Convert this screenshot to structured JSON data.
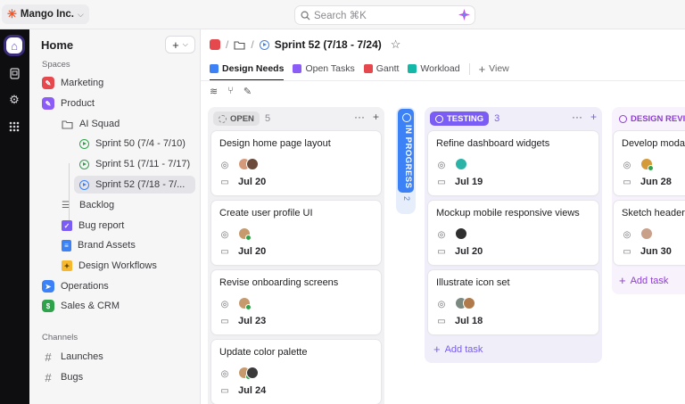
{
  "topbar": {
    "workspace": "Mango Inc.",
    "search_placeholder": "Search ⌘K"
  },
  "sidebar": {
    "title": "Home",
    "spaces_label": "Spaces",
    "channels_label": "Channels",
    "spaces": [
      {
        "label": "Marketing",
        "color": "#e5484d"
      },
      {
        "label": "Product",
        "color": "#8b5cf6"
      },
      {
        "label": "AI Squad"
      },
      {
        "label": "Sprint 50 (7/4 - 7/10)"
      },
      {
        "label": "Sprint 51 (7/11 - 7/17)"
      },
      {
        "label": "Sprint 52 (7/18 - 7/..."
      },
      {
        "label": "Backlog"
      },
      {
        "label": "Bug report"
      },
      {
        "label": "Brand Assets"
      },
      {
        "label": "Design Workflows"
      },
      {
        "label": "Operations",
        "color": "#3c82f6"
      },
      {
        "label": "Sales & CRM",
        "color": "#2fa34b",
        "letter": "$"
      }
    ],
    "channels": [
      {
        "label": "Launches"
      },
      {
        "label": "Bugs"
      }
    ]
  },
  "main": {
    "title": "Sprint 52 (7/18 - 7/24)",
    "tabs": [
      {
        "label": "Design Needs",
        "color": "#3c82f6"
      },
      {
        "label": "Open Tasks",
        "color": "#8b5cf6"
      },
      {
        "label": "Gantt",
        "color": "#e5484d"
      },
      {
        "label": "Workload",
        "color": "#14b8a6"
      },
      {
        "label": "View"
      }
    ]
  },
  "board": {
    "open": {
      "label": "OPEN",
      "count": "5",
      "cards": [
        {
          "title": "Design home page layout",
          "date": "Jul 20"
        },
        {
          "title": "Create user profile UI",
          "date": "Jul 20"
        },
        {
          "title": "Revise onboarding screens",
          "date": "Jul 23"
        },
        {
          "title": "Update color palette",
          "date": "Jul 24"
        }
      ]
    },
    "in_progress": {
      "label": "IN PROGRESS",
      "count": "2"
    },
    "testing": {
      "label": "TESTING",
      "count": "3",
      "cards": [
        {
          "title": "Refine dashboard widgets",
          "date": "Jul 19"
        },
        {
          "title": "Mockup mobile responsive views",
          "date": "Jul 20"
        },
        {
          "title": "Illustrate icon set",
          "date": "Jul 18"
        }
      ],
      "add_task": "Add task"
    },
    "design_review": {
      "label": "DESIGN REVIE",
      "cards": [
        {
          "title": "Develop moda",
          "date": "Jun 28"
        },
        {
          "title": "Sketch header",
          "date": "Jun 30"
        }
      ],
      "add_task": "Add task"
    }
  },
  "colors": {
    "accent": "#7b5cf5",
    "in_progress": "#3c82f6",
    "review": "#8d3fd1"
  }
}
